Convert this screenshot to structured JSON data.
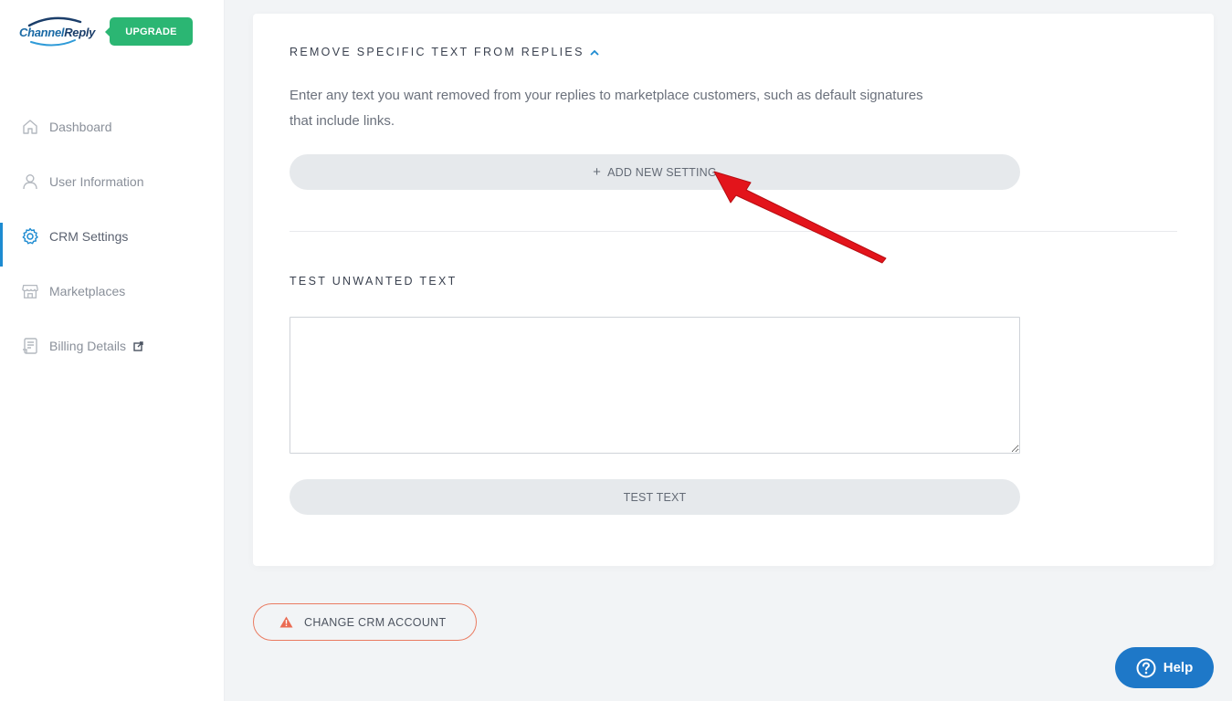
{
  "brand": {
    "name_part1": "Channel",
    "name_part2": "Reply"
  },
  "sidebar": {
    "upgrade_label": "UPGRADE",
    "items": [
      {
        "label": "Dashboard",
        "icon": "home-icon"
      },
      {
        "label": "User Information",
        "icon": "user-icon"
      },
      {
        "label": "CRM Settings",
        "icon": "gear-icon",
        "active": true
      },
      {
        "label": "Marketplaces",
        "icon": "store-icon"
      },
      {
        "label": "Billing Details",
        "icon": "billing-icon",
        "external": true
      }
    ]
  },
  "remove_section": {
    "title": "REMOVE SPECIFIC TEXT FROM REPLIES",
    "description": "Enter any text you want removed from your replies to marketplace customers, such as default signatures that include links.",
    "add_button_label": "ADD NEW SETTING"
  },
  "test_section": {
    "title": "TEST UNWANTED TEXT",
    "textarea_value": "",
    "test_button_label": "TEST TEXT"
  },
  "change_account_label": "CHANGE CRM ACCOUNT",
  "help_label": "Help",
  "colors": {
    "accent": "#1d8bd1",
    "upgrade": "#2bb673",
    "danger": "#ea7b61",
    "help": "#1e78c8",
    "annotation_arrow": "#e3141b"
  }
}
